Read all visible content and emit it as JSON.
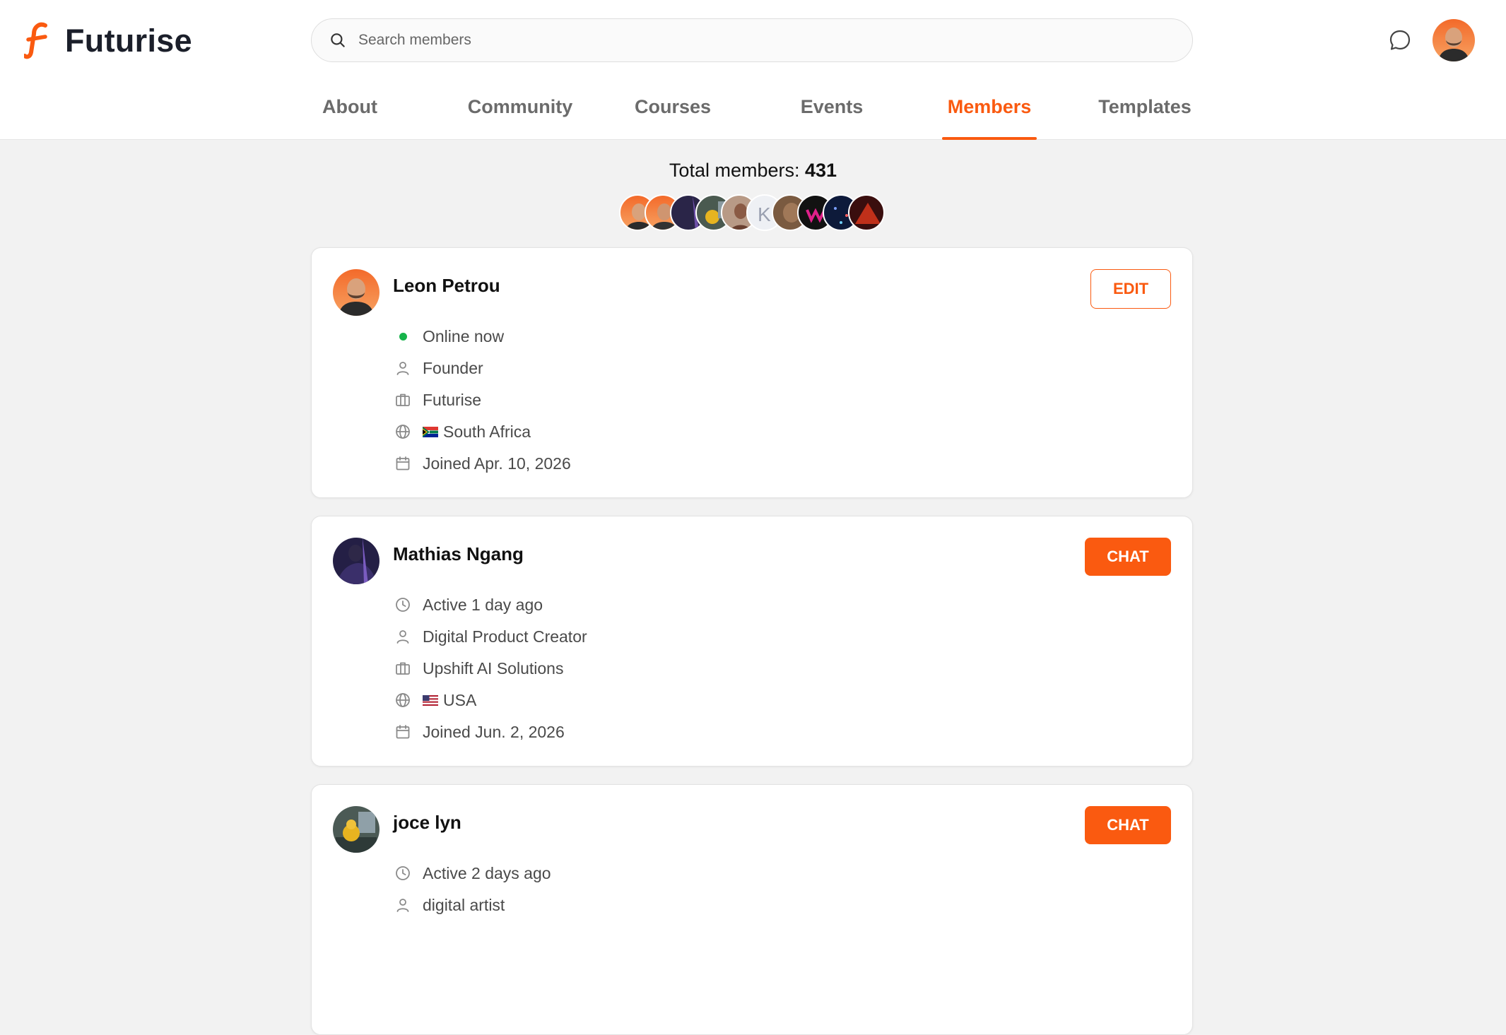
{
  "brand": {
    "name": "Futurise",
    "accent": "#fa5a10"
  },
  "search": {
    "placeholder": "Search members"
  },
  "header": {
    "chat_icon": "chat-bubble-icon",
    "avatar_icon": "user-avatar"
  },
  "tabs": [
    {
      "label": "About",
      "active": false
    },
    {
      "label": "Community",
      "active": false
    },
    {
      "label": "Courses",
      "active": false
    },
    {
      "label": "Events",
      "active": false
    },
    {
      "label": "Members",
      "active": true
    },
    {
      "label": "Templates",
      "active": false
    }
  ],
  "totals": {
    "label": "Total members:",
    "count": "431"
  },
  "members": [
    {
      "name": "Leon Petrou",
      "action": "EDIT",
      "status": "Online now",
      "role": "Founder",
      "company": "Futurise",
      "country": "South Africa",
      "joined": "Joined Apr. 10, 2026"
    },
    {
      "name": "Mathias Ngang",
      "action": "CHAT",
      "status": "Active 1 day ago",
      "role": "Digital Product Creator",
      "company": "Upshift AI Solutions",
      "country": "USA",
      "joined": "Joined Jun. 2, 2026"
    },
    {
      "name": "joce lyn",
      "action": "CHAT",
      "status": "Active 2 days ago",
      "role": "digital artist"
    }
  ]
}
